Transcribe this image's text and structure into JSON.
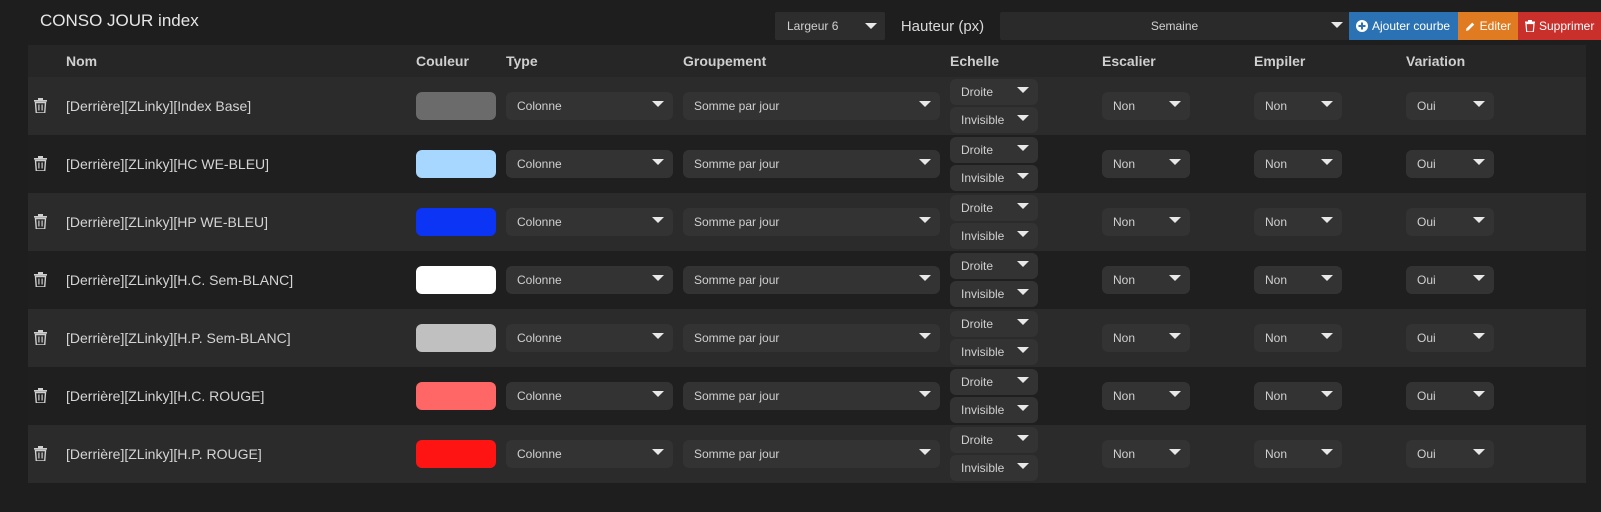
{
  "title": "CONSO JOUR index",
  "toolbar": {
    "largeur": "Largeur 6",
    "hauteur_label": "Hauteur (px)",
    "periode": "Semaine",
    "add_label": "Ajouter courbe",
    "edit_label": "Editer",
    "delete_label": "Supprimer",
    "colors": {
      "add": "#2b72b4",
      "edit": "#e07b21",
      "delete": "#c9302c"
    }
  },
  "columns": {
    "nom": "Nom",
    "couleur": "Couleur",
    "type": "Type",
    "groupement": "Groupement",
    "echelle": "Echelle",
    "escalier": "Escalier",
    "empiler": "Empiler",
    "variation": "Variation"
  },
  "rows": [
    {
      "name": "[Derrière][ZLinky][Index Base]",
      "color": "#6b6b6b",
      "type": "Colonne",
      "groupement": "Somme par jour",
      "echelle_side": "Droite",
      "echelle_vis": "Invisible",
      "escalier": "Non",
      "empiler": "Non",
      "variation": "Oui"
    },
    {
      "name": "[Derrière][ZLinky][HC WE-BLEU]",
      "color": "#a7d6ff",
      "type": "Colonne",
      "groupement": "Somme par jour",
      "echelle_side": "Droite",
      "echelle_vis": "Invisible",
      "escalier": "Non",
      "empiler": "Non",
      "variation": "Oui"
    },
    {
      "name": "[Derrière][ZLinky][HP WE-BLEU]",
      "color": "#0b34f5",
      "type": "Colonne",
      "groupement": "Somme par jour",
      "echelle_side": "Droite",
      "echelle_vis": "Invisible",
      "escalier": "Non",
      "empiler": "Non",
      "variation": "Oui"
    },
    {
      "name": "[Derrière][ZLinky][H.C. Sem-BLANC]",
      "color": "#ffffff",
      "type": "Colonne",
      "groupement": "Somme par jour",
      "echelle_side": "Droite",
      "echelle_vis": "Invisible",
      "escalier": "Non",
      "empiler": "Non",
      "variation": "Oui"
    },
    {
      "name": "[Derrière][ZLinky][H.P. Sem-BLANC]",
      "color": "#c0c0c0",
      "type": "Colonne",
      "groupement": "Somme par jour",
      "echelle_side": "Droite",
      "echelle_vis": "Invisible",
      "escalier": "Non",
      "empiler": "Non",
      "variation": "Oui"
    },
    {
      "name": "[Derrière][ZLinky][H.C. ROUGE]",
      "color": "#ff6666",
      "type": "Colonne",
      "groupement": "Somme par jour",
      "echelle_side": "Droite",
      "echelle_vis": "Invisible",
      "escalier": "Non",
      "empiler": "Non",
      "variation": "Oui"
    },
    {
      "name": "[Derrière][ZLinky][H.P. ROUGE]",
      "color": "#ff1414",
      "type": "Colonne",
      "groupement": "Somme par jour",
      "echelle_side": "Droite",
      "echelle_vis": "Invisible",
      "escalier": "Non",
      "empiler": "Non",
      "variation": "Oui"
    }
  ]
}
